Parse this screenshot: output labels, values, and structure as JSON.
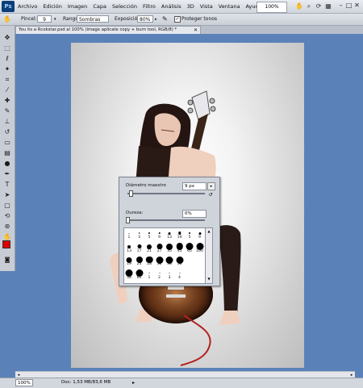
{
  "menubar": {
    "app_badge": "Ps",
    "menus": [
      "Archivo",
      "Edición",
      "Imagen",
      "Capa",
      "Selección",
      "Filtro",
      "Análisis",
      "3D",
      "Vista",
      "Ventana",
      "Ayuda"
    ],
    "zoom": "100%"
  },
  "options": {
    "pincel_label": "Pincel:",
    "brush_size": "9",
    "rango_label": "Rango:",
    "rango_value": "Sombras",
    "exposicion_label": "Exposición:",
    "exposicion_value": "80%",
    "proteger_label": "Proteger tonos"
  },
  "document": {
    "tab_title": "You its a Rcokstar.psd al 100% (image aplicate copy + burn tool, RGB/8) *"
  },
  "brush_popup": {
    "diameter_label": "Diámetro maestro",
    "diameter_value": "9 px",
    "hardness_label": "Dureza:",
    "hardness_value": "0%",
    "presets": [
      {
        "size": "1",
        "d": 1
      },
      {
        "size": "3",
        "d": 1.5
      },
      {
        "size": "5",
        "d": 2
      },
      {
        "size": "9",
        "d": 2.5
      },
      {
        "size": "13",
        "d": 3
      },
      {
        "size": "19",
        "d": 3.5
      },
      {
        "size": "5",
        "d": 2
      },
      {
        "size": "9",
        "d": 3
      },
      {
        "size": "13",
        "d": 4
      },
      {
        "size": "17",
        "d": 5
      },
      {
        "size": "21",
        "d": 6
      },
      {
        "size": "27",
        "d": 7
      },
      {
        "size": "35",
        "d": 8
      },
      {
        "size": "45",
        "d": 8.5
      },
      {
        "size": "65",
        "d": 9
      },
      {
        "size": "100",
        "d": 9
      },
      {
        "size": "19",
        "d": 7
      },
      {
        "size": "24",
        "d": 8
      },
      {
        "size": "28",
        "d": 8.5
      },
      {
        "size": "32",
        "d": 9
      },
      {
        "size": "33",
        "d": 9
      },
      {
        "size": "36",
        "d": 9
      },
      {
        "size": "",
        "d": 0
      },
      {
        "size": "",
        "d": 0
      },
      {
        "size": "48",
        "d": 9
      },
      {
        "size": "60",
        "d": 9
      },
      {
        "size": "1",
        "d": 1
      },
      {
        "size": "2",
        "d": 1
      },
      {
        "size": "3",
        "d": 1
      },
      {
        "size": "4",
        "d": 1
      },
      {
        "size": "",
        "d": 0
      },
      {
        "size": "",
        "d": 0
      }
    ]
  },
  "status": {
    "zoom": "100%",
    "doc_info": "Doc: 1,53 MB/83,6 MB"
  },
  "colors": {
    "background": "#5b82b8",
    "foreground_swatch": "#e00000",
    "background_swatch": "#ffffff"
  },
  "icons": [
    "move-icon",
    "marquee-icon",
    "lasso-icon",
    "quick-select-icon",
    "crop-icon",
    "eyedropper-icon",
    "healing-icon",
    "brush-icon",
    "clone-stamp-icon",
    "history-brush-icon",
    "eraser-icon",
    "gradient-icon",
    "burn-icon",
    "pen-icon",
    "type-icon",
    "path-select-icon",
    "shape-icon",
    "3d-rotate-icon",
    "3d-orbit-icon",
    "hand-icon",
    "zoom-icon"
  ]
}
